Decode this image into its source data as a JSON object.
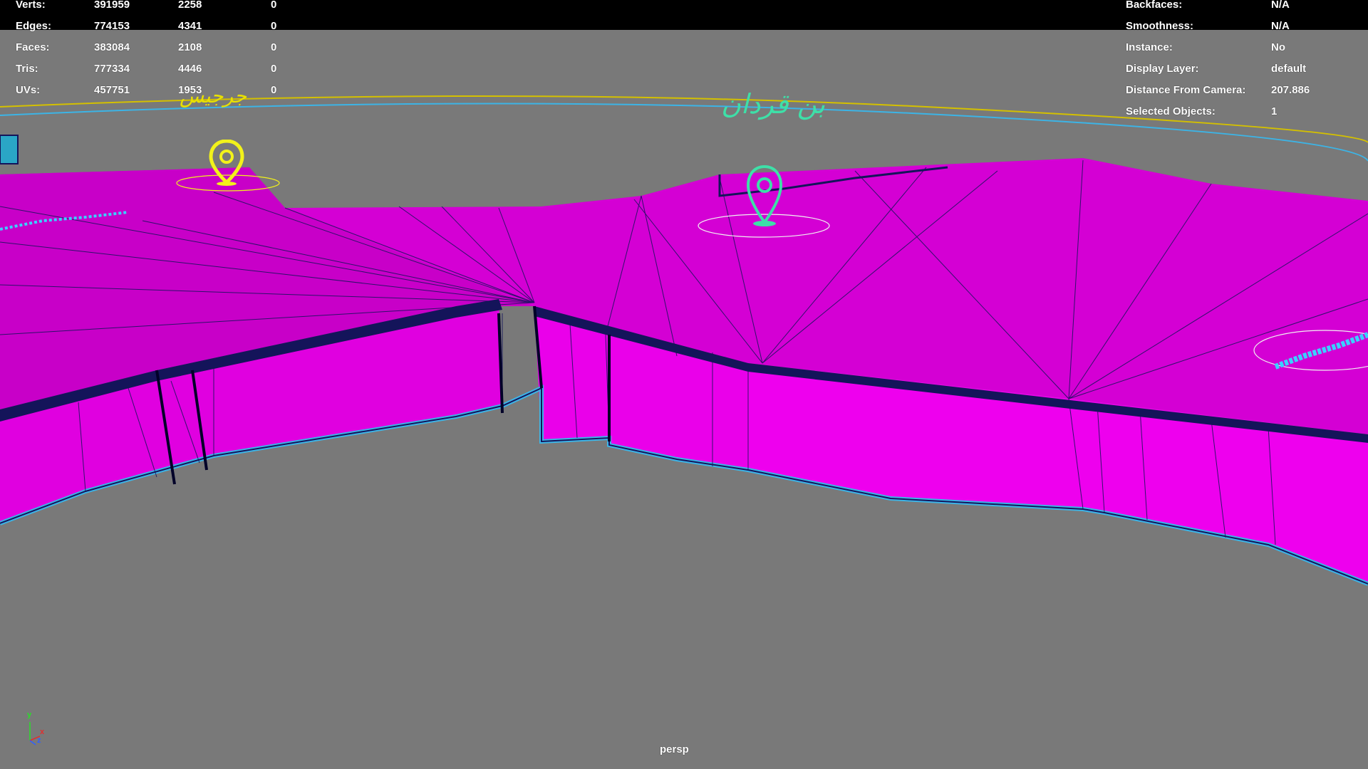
{
  "hud_left": {
    "rows": [
      {
        "label": "Verts:",
        "v1": "391959",
        "v2": "2258",
        "v3": "0"
      },
      {
        "label": "Edges:",
        "v1": "774153",
        "v2": "4341",
        "v3": "0"
      },
      {
        "label": "Faces:",
        "v1": "383084",
        "v2": "2108",
        "v3": "0"
      },
      {
        "label": "Tris:",
        "v1": "777334",
        "v2": "4446",
        "v3": "0"
      },
      {
        "label": "UVs:",
        "v1": "457751",
        "v2": "1953",
        "v3": "0"
      }
    ]
  },
  "hud_right": {
    "rows": [
      {
        "label": "Backfaces:",
        "value": "N/A"
      },
      {
        "label": "Smoothness:",
        "value": "N/A"
      },
      {
        "label": "Instance:",
        "value": "No"
      },
      {
        "label": "Display Layer:",
        "value": "default"
      },
      {
        "label": "Distance From Camera:",
        "value": "207.886"
      },
      {
        "label": "Selected Objects:",
        "value": "1"
      }
    ]
  },
  "scene": {
    "arabic_label_left": "جرجيس",
    "arabic_label_center": "بن قردان",
    "pin_left_icon": "map-pin-icon",
    "pin_center_icon": "map-pin-icon",
    "colors": {
      "mesh": "#e800e8",
      "wire": "#14145a",
      "pin_left": "#f2f21a",
      "pin_center": "#3ee0a8",
      "curve_yellow": "#d4c000",
      "curve_cyan": "#3cb4e6"
    }
  },
  "axis": {
    "x": "x",
    "y": "y",
    "z": "z"
  },
  "camera": {
    "name": "persp"
  }
}
